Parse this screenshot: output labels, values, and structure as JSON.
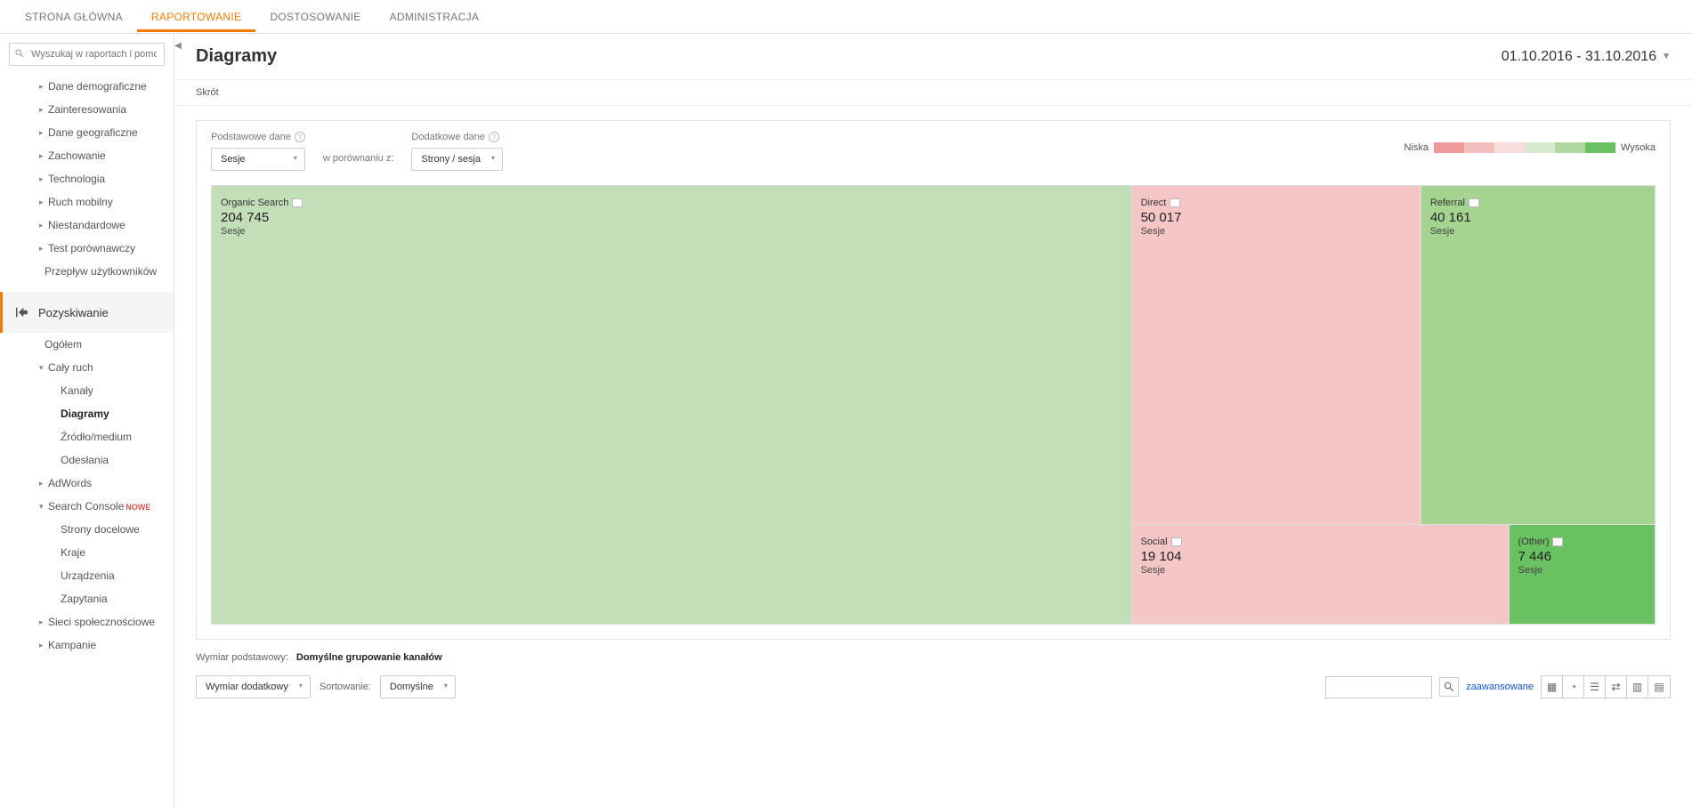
{
  "topnav": {
    "items": [
      "STRONA GŁÓWNA",
      "RAPORTOWANIE",
      "DOSTOSOWANIE",
      "ADMINISTRACJA"
    ],
    "active": 1
  },
  "search": {
    "placeholder": "Wyszukaj w raportach i pomocy"
  },
  "sidebar": {
    "items_top": [
      "Dane demograficzne",
      "Zainteresowania",
      "Dane geograficzne",
      "Zachowanie",
      "Technologia",
      "Ruch mobilny",
      "Niestandardowe",
      "Test porównawczy"
    ],
    "flow": "Przepływ użytkowników",
    "section": "Pozyskiwanie",
    "overview": "Ogółem",
    "all_traffic": "Cały ruch",
    "all_traffic_items": [
      "Kanały",
      "Diagramy",
      "Źródło/medium",
      "Odesłania"
    ],
    "adwords": "AdWords",
    "search_console": "Search Console",
    "search_console_badge": "NOWE",
    "search_console_items": [
      "Strony docelowe",
      "Kraje",
      "Urządzenia",
      "Zapytania"
    ],
    "social": "Sieci społecznościowe",
    "campaigns": "Kampanie"
  },
  "header": {
    "title": "Diagramy",
    "date_range": "01.10.2016 - 31.10.2016",
    "shortcut": "Skrót"
  },
  "controls": {
    "primary_label": "Podstawowe dane",
    "primary_value": "Sesje",
    "compare_text": "w porównaniu z:",
    "secondary_label": "Dodatkowe dane",
    "secondary_value": "Strony / sesja",
    "legend_low": "Niska",
    "legend_high": "Wysoka"
  },
  "chart_data": {
    "type": "treemap",
    "metric_label": "Sesje",
    "cells": [
      {
        "key": "organic",
        "label": "Organic Search",
        "value": "204 745",
        "num": 204745,
        "color": "#c3dfb8"
      },
      {
        "key": "direct",
        "label": "Direct",
        "value": "50 017",
        "num": 50017,
        "color": "#f4c6c6"
      },
      {
        "key": "referral",
        "label": "Referral",
        "value": "40 161",
        "num": 40161,
        "color": "#a4d48f"
      },
      {
        "key": "social",
        "label": "Social",
        "value": "19 104",
        "num": 19104,
        "color": "#f4c6c6"
      },
      {
        "key": "other",
        "label": "(Other)",
        "value": "7 446",
        "num": 7446,
        "color": "#6ac162"
      }
    ]
  },
  "footer": {
    "dim_label": "Wymiar podstawowy:",
    "dim_value": "Domyślne grupowanie kanałów",
    "extra_dim": "Wymiar dodatkowy",
    "sort_label": "Sortowanie:",
    "sort_value": "Domyślne",
    "advanced": "zaawansowane"
  }
}
